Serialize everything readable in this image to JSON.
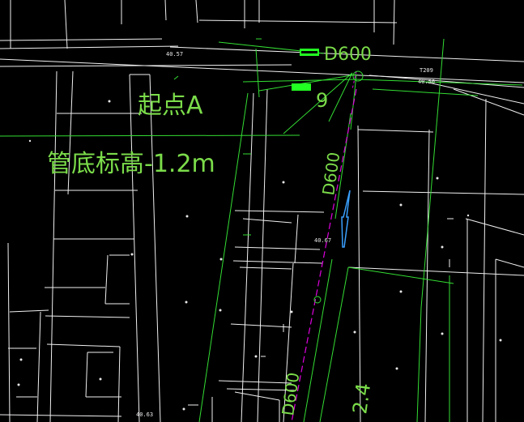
{
  "annotations": {
    "start_label": "起点A",
    "pipe_bottom_elevation": "管底标高-1.2m",
    "pipe_diameter_top": "D600",
    "pipe_diameter_mid": "D600",
    "pipe_diameter_bottom": "D600",
    "number_nine": "9",
    "number_24": "2.4"
  },
  "elevations": {
    "e1": "40.57",
    "e2": "40.56",
    "e3": "40.67",
    "e4": "40.63"
  },
  "codes": {
    "t209": "T209"
  },
  "colors": {
    "background": "#000000",
    "building_lines": "#ffffff",
    "pipe_lines": "#33dd33",
    "pipe_marker": "#22ff22",
    "dashed_centerline": "#e000e0",
    "arrow": "#3aa0ff"
  }
}
